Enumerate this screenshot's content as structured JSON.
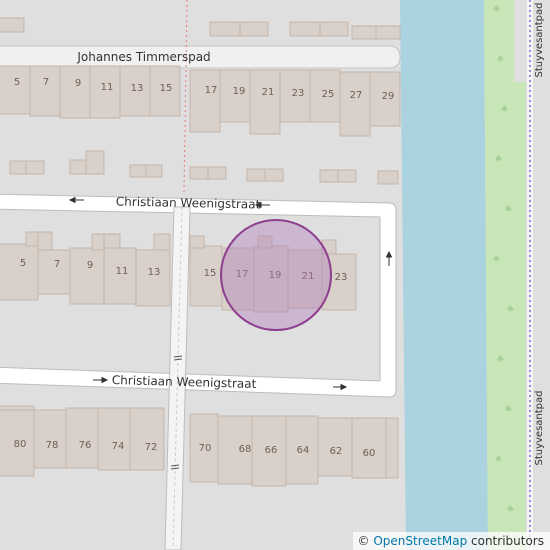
{
  "map": {
    "streets": {
      "johannes": "Johannes Timmerspad",
      "christiaan_top": "Christiaan Weenigstraat",
      "christiaan_bottom": "Christiaan Weenigstraat",
      "stuyvesant_upper": "Stuyvesantpad",
      "stuyvesant_lower": "Stuyvesantpad"
    },
    "house_numbers": {
      "row1_left": [
        "5",
        "7",
        "9",
        "11",
        "13",
        "15"
      ],
      "row1_right": [
        "17",
        "19",
        "21",
        "23",
        "25",
        "27",
        "29"
      ],
      "row2_left": [
        "5",
        "7",
        "9",
        "11",
        "13"
      ],
      "row2_right": [
        "15",
        "17",
        "19",
        "21",
        "23"
      ],
      "row3_left": [
        "80",
        "78",
        "76",
        "74",
        "72"
      ],
      "row3_right": [
        "70",
        "68",
        "66",
        "64",
        "62",
        "60"
      ]
    },
    "marker": {
      "fill": "#b07ab8",
      "stroke": "#8e3e8e"
    },
    "colors": {
      "background": "#e0dfdf",
      "building": "#d9d0c9",
      "building_stroke": "#c4b6ab",
      "road": "#ffffff",
      "road_casing": "#bdbdbd",
      "water": "#aad3df",
      "grass": "#c8e6b8"
    }
  },
  "attribution": {
    "symbol": "©",
    "link_text": "OpenStreetMap",
    "suffix": "contributors"
  }
}
